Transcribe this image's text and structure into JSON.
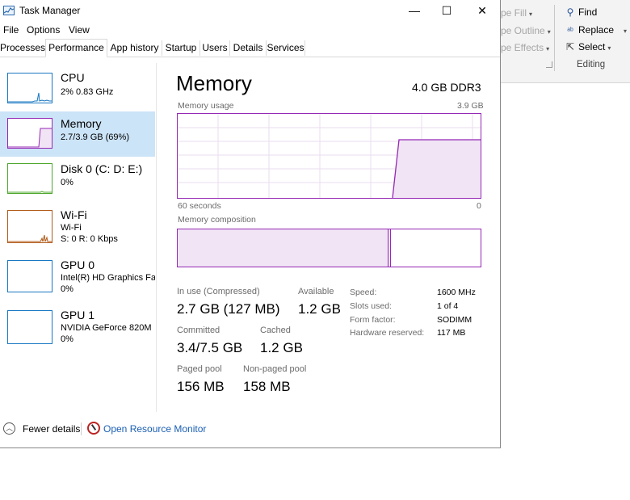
{
  "ribbon": {
    "shape_fill": "pe Fill",
    "shape_outline": "pe Outline",
    "shape_effects": "pe Effects",
    "find": "Find",
    "replace": "Replace",
    "select": "Select",
    "group_label": "Editing"
  },
  "window": {
    "title": "Task Manager",
    "minimize": "—",
    "maximize": "☐",
    "close": "✕"
  },
  "menu": [
    "File",
    "Options",
    "View"
  ],
  "tabs": [
    "Processes",
    "Performance",
    "App history",
    "Startup",
    "Users",
    "Details",
    "Services"
  ],
  "active_tab": "Performance",
  "sidebar": [
    {
      "title": "CPU",
      "line1": "2%  0.83 GHz",
      "line2": "",
      "line3": "",
      "color": "#1a78c2"
    },
    {
      "title": "Memory",
      "line1": "2.7/3.9 GB (69%)",
      "line2": "",
      "line3": "",
      "color": "#9528b4",
      "selected": true
    },
    {
      "title": "Disk 0 (C: D: E:)",
      "line1": "0%",
      "line2": "",
      "line3": "",
      "color": "#4ea72e"
    },
    {
      "title": "Wi-Fi",
      "line1": "Wi-Fi",
      "line2": "S: 0  R: 0 Kbps",
      "line3": "",
      "color": "#b05a1a"
    },
    {
      "title": "GPU 0",
      "line1": "Intel(R) HD Graphics Far",
      "line2": "0%",
      "line3": "",
      "color": "#1a78c2"
    },
    {
      "title": "GPU 1",
      "line1": "NVIDIA GeForce 820M",
      "line2": "0%",
      "line3": "",
      "color": "#1a78c2"
    }
  ],
  "main": {
    "title": "Memory",
    "spec": "4.0 GB DDR3",
    "usage_label": "Memory usage",
    "usage_max": "3.9 GB",
    "time_left": "60 seconds",
    "time_right": "0",
    "composition_label": "Memory composition",
    "usage_fraction": 0.69,
    "stats": {
      "in_use_label": "In use (Compressed)",
      "in_use_value": "2.7 GB (127 MB)",
      "available_label": "Available",
      "available_value": "1.2 GB",
      "committed_label": "Committed",
      "committed_value": "3.4/7.5 GB",
      "cached_label": "Cached",
      "cached_value": "1.2 GB",
      "paged_label": "Paged pool",
      "paged_value": "156 MB",
      "nonpaged_label": "Non-paged pool",
      "nonpaged_value": "158 MB"
    },
    "details": [
      {
        "key": "Speed:",
        "value": "1600 MHz"
      },
      {
        "key": "Slots used:",
        "value": "1 of 4"
      },
      {
        "key": "Form factor:",
        "value": "SODIMM"
      },
      {
        "key": "Hardware reserved:",
        "value": "117 MB"
      }
    ]
  },
  "footer": {
    "fewer_details": "Fewer details",
    "resource_monitor": "Open Resource Monitor"
  },
  "colors": {
    "memory": "#9528b4",
    "selection": "#cce4f7",
    "link": "#1a5fb4"
  }
}
